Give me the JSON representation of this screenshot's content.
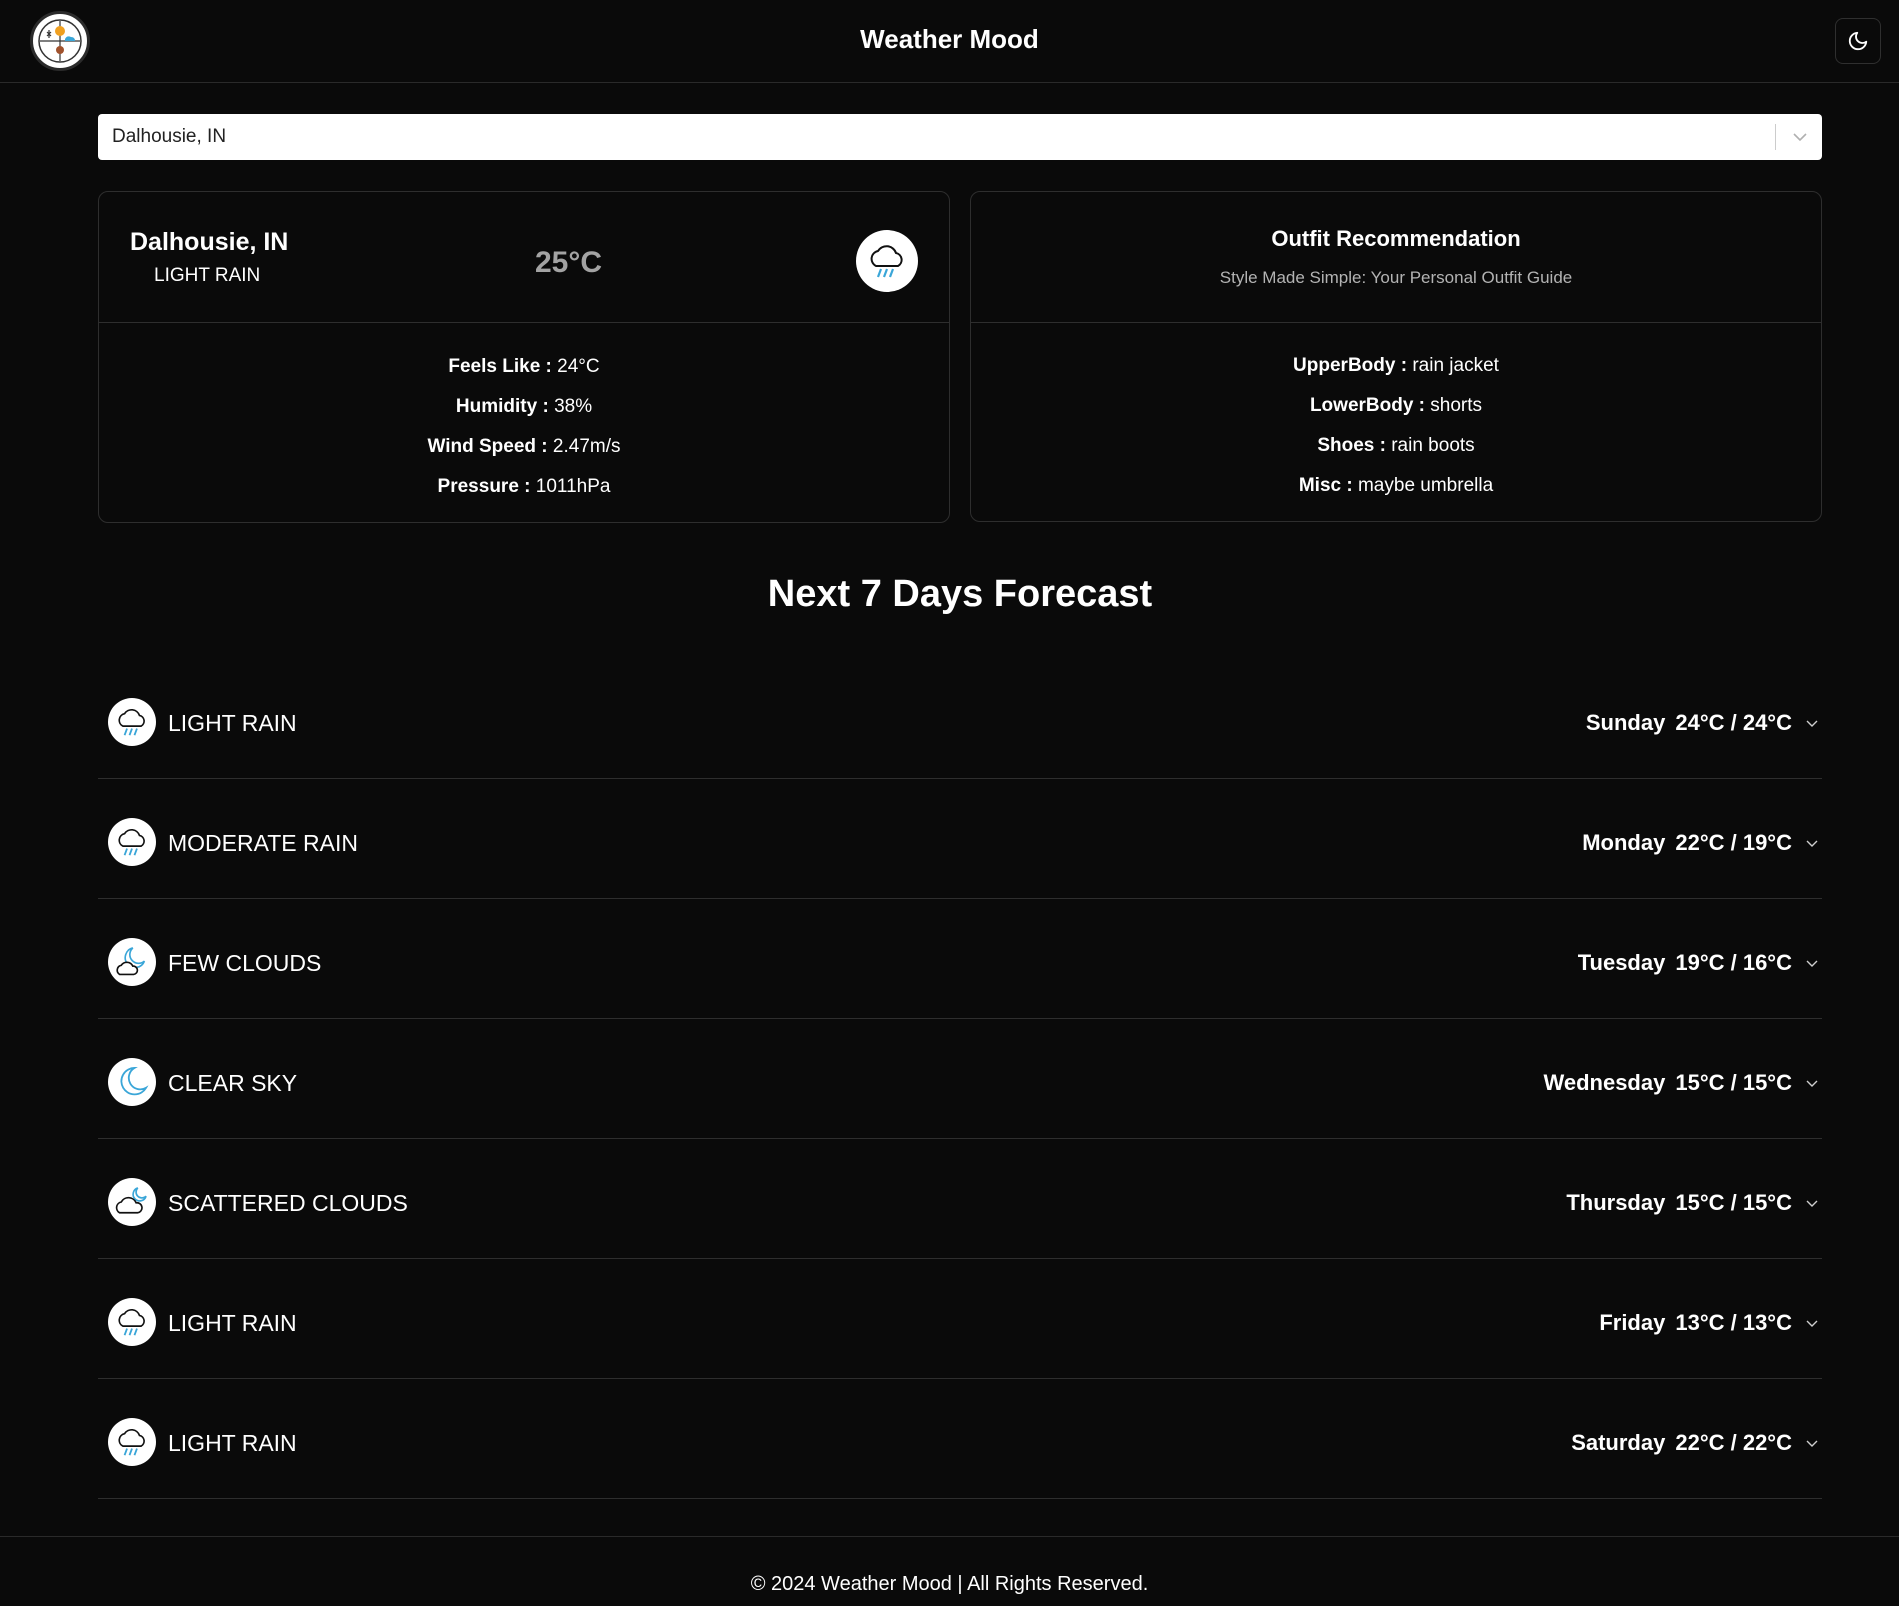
{
  "header": {
    "title": "Weather Mood",
    "logo_icon": "weather-collage-logo",
    "theme_icon": "moon-icon"
  },
  "search": {
    "selected_value": "Dalhousie, IN"
  },
  "current": {
    "city": "Dalhousie, IN",
    "condition": "LIGHT RAIN",
    "temperature": "25°C",
    "icon": "rain-cloud-icon",
    "details": {
      "feels_like_label": "Feels Like :",
      "feels_like_value": "24°C",
      "humidity_label": "Humidity :",
      "humidity_value": "38%",
      "wind_label": "Wind Speed :",
      "wind_value": "2.47m/s",
      "pressure_label": "Pressure :",
      "pressure_value": "1011hPa"
    }
  },
  "outfit": {
    "title": "Outfit Recommendation",
    "subtitle": "Style Made Simple: Your Personal Outfit Guide",
    "upper_label": "UpperBody :",
    "upper_value": "rain jacket",
    "lower_label": "LowerBody :",
    "lower_value": "shorts",
    "shoes_label": "Shoes :",
    "shoes_value": "rain boots",
    "misc_label": "Misc :",
    "misc_value": "maybe umbrella"
  },
  "forecast": {
    "title": "Next 7 Days Forecast",
    "days": [
      {
        "condition": "LIGHT RAIN",
        "day": "Sunday",
        "temps": "24°C / 24°C",
        "icon": "rain-cloud-icon"
      },
      {
        "condition": "MODERATE RAIN",
        "day": "Monday",
        "temps": "22°C / 19°C",
        "icon": "rain-cloud-icon"
      },
      {
        "condition": "FEW CLOUDS",
        "day": "Tuesday",
        "temps": "19°C / 16°C",
        "icon": "moon-cloud-icon"
      },
      {
        "condition": "CLEAR SKY",
        "day": "Wednesday",
        "temps": "15°C / 15°C",
        "icon": "moon-icon"
      },
      {
        "condition": "SCATTERED CLOUDS",
        "day": "Thursday",
        "temps": "15°C / 15°C",
        "icon": "cloud-icon"
      },
      {
        "condition": "LIGHT RAIN",
        "day": "Friday",
        "temps": "13°C / 13°C",
        "icon": "rain-cloud-icon"
      },
      {
        "condition": "LIGHT RAIN",
        "day": "Saturday",
        "temps": "22°C / 22°C",
        "icon": "rain-cloud-icon"
      }
    ]
  },
  "footer": {
    "text": "© 2024 Weather Mood | All Rights Reserved."
  },
  "colors": {
    "background": "#0a0a0a",
    "border": "#2e2e2e",
    "text": "#ffffff",
    "muted": "#b3b3b3",
    "temp": "#a3a3a3",
    "rain_accent": "#3aa6d8"
  }
}
